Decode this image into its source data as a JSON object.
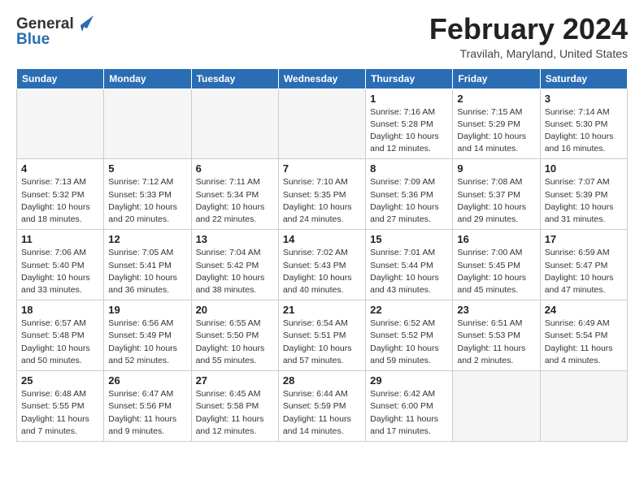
{
  "logo": {
    "general": "General",
    "blue": "Blue"
  },
  "header": {
    "month_year": "February 2024",
    "location": "Travilah, Maryland, United States"
  },
  "days_of_week": [
    "Sunday",
    "Monday",
    "Tuesday",
    "Wednesday",
    "Thursday",
    "Friday",
    "Saturday"
  ],
  "weeks": [
    [
      {
        "day": "",
        "empty": true
      },
      {
        "day": "",
        "empty": true
      },
      {
        "day": "",
        "empty": true
      },
      {
        "day": "",
        "empty": true
      },
      {
        "day": "1",
        "sunrise": "7:16 AM",
        "sunset": "5:28 PM",
        "daylight": "10 hours and 12 minutes."
      },
      {
        "day": "2",
        "sunrise": "7:15 AM",
        "sunset": "5:29 PM",
        "daylight": "10 hours and 14 minutes."
      },
      {
        "day": "3",
        "sunrise": "7:14 AM",
        "sunset": "5:30 PM",
        "daylight": "10 hours and 16 minutes."
      }
    ],
    [
      {
        "day": "4",
        "sunrise": "7:13 AM",
        "sunset": "5:32 PM",
        "daylight": "10 hours and 18 minutes."
      },
      {
        "day": "5",
        "sunrise": "7:12 AM",
        "sunset": "5:33 PM",
        "daylight": "10 hours and 20 minutes."
      },
      {
        "day": "6",
        "sunrise": "7:11 AM",
        "sunset": "5:34 PM",
        "daylight": "10 hours and 22 minutes."
      },
      {
        "day": "7",
        "sunrise": "7:10 AM",
        "sunset": "5:35 PM",
        "daylight": "10 hours and 24 minutes."
      },
      {
        "day": "8",
        "sunrise": "7:09 AM",
        "sunset": "5:36 PM",
        "daylight": "10 hours and 27 minutes."
      },
      {
        "day": "9",
        "sunrise": "7:08 AM",
        "sunset": "5:37 PM",
        "daylight": "10 hours and 29 minutes."
      },
      {
        "day": "10",
        "sunrise": "7:07 AM",
        "sunset": "5:39 PM",
        "daylight": "10 hours and 31 minutes."
      }
    ],
    [
      {
        "day": "11",
        "sunrise": "7:06 AM",
        "sunset": "5:40 PM",
        "daylight": "10 hours and 33 minutes."
      },
      {
        "day": "12",
        "sunrise": "7:05 AM",
        "sunset": "5:41 PM",
        "daylight": "10 hours and 36 minutes."
      },
      {
        "day": "13",
        "sunrise": "7:04 AM",
        "sunset": "5:42 PM",
        "daylight": "10 hours and 38 minutes."
      },
      {
        "day": "14",
        "sunrise": "7:02 AM",
        "sunset": "5:43 PM",
        "daylight": "10 hours and 40 minutes."
      },
      {
        "day": "15",
        "sunrise": "7:01 AM",
        "sunset": "5:44 PM",
        "daylight": "10 hours and 43 minutes."
      },
      {
        "day": "16",
        "sunrise": "7:00 AM",
        "sunset": "5:45 PM",
        "daylight": "10 hours and 45 minutes."
      },
      {
        "day": "17",
        "sunrise": "6:59 AM",
        "sunset": "5:47 PM",
        "daylight": "10 hours and 47 minutes."
      }
    ],
    [
      {
        "day": "18",
        "sunrise": "6:57 AM",
        "sunset": "5:48 PM",
        "daylight": "10 hours and 50 minutes."
      },
      {
        "day": "19",
        "sunrise": "6:56 AM",
        "sunset": "5:49 PM",
        "daylight": "10 hours and 52 minutes."
      },
      {
        "day": "20",
        "sunrise": "6:55 AM",
        "sunset": "5:50 PM",
        "daylight": "10 hours and 55 minutes."
      },
      {
        "day": "21",
        "sunrise": "6:54 AM",
        "sunset": "5:51 PM",
        "daylight": "10 hours and 57 minutes."
      },
      {
        "day": "22",
        "sunrise": "6:52 AM",
        "sunset": "5:52 PM",
        "daylight": "10 hours and 59 minutes."
      },
      {
        "day": "23",
        "sunrise": "6:51 AM",
        "sunset": "5:53 PM",
        "daylight": "11 hours and 2 minutes."
      },
      {
        "day": "24",
        "sunrise": "6:49 AM",
        "sunset": "5:54 PM",
        "daylight": "11 hours and 4 minutes."
      }
    ],
    [
      {
        "day": "25",
        "sunrise": "6:48 AM",
        "sunset": "5:55 PM",
        "daylight": "11 hours and 7 minutes."
      },
      {
        "day": "26",
        "sunrise": "6:47 AM",
        "sunset": "5:56 PM",
        "daylight": "11 hours and 9 minutes."
      },
      {
        "day": "27",
        "sunrise": "6:45 AM",
        "sunset": "5:58 PM",
        "daylight": "11 hours and 12 minutes."
      },
      {
        "day": "28",
        "sunrise": "6:44 AM",
        "sunset": "5:59 PM",
        "daylight": "11 hours and 14 minutes."
      },
      {
        "day": "29",
        "sunrise": "6:42 AM",
        "sunset": "6:00 PM",
        "daylight": "11 hours and 17 minutes."
      },
      {
        "day": "",
        "empty": true
      },
      {
        "day": "",
        "empty": true
      }
    ]
  ],
  "labels": {
    "sunrise_prefix": "Sunrise: ",
    "sunset_prefix": "Sunset: ",
    "daylight_prefix": "Daylight: "
  }
}
